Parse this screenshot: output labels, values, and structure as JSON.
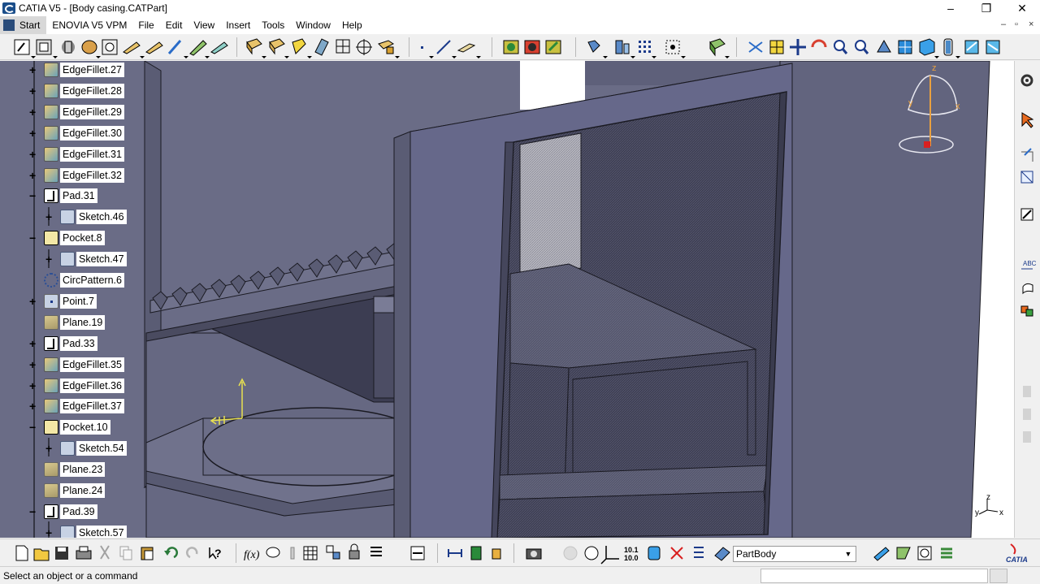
{
  "window": {
    "title": "CATIA V5 - [Body casing.CATPart]",
    "minimize": "–",
    "restore": "❐",
    "close": "✕"
  },
  "menu": {
    "items": [
      "Start",
      "ENOVIA V5 VPM",
      "File",
      "Edit",
      "View",
      "Insert",
      "Tools",
      "Window",
      "Help"
    ],
    "mdi_controls": [
      "–",
      "▫",
      "×"
    ]
  },
  "spec_tree": {
    "items": [
      {
        "label": "EdgeFillet.27",
        "type": "fillet",
        "level": 0,
        "expand": "+"
      },
      {
        "label": "EdgeFillet.28",
        "type": "fillet",
        "level": 0,
        "expand": "+"
      },
      {
        "label": "EdgeFillet.29",
        "type": "fillet",
        "level": 0,
        "expand": "+"
      },
      {
        "label": "EdgeFillet.30",
        "type": "fillet",
        "level": 0,
        "expand": "+"
      },
      {
        "label": "EdgeFillet.31",
        "type": "fillet",
        "level": 0,
        "expand": "+"
      },
      {
        "label": "EdgeFillet.32",
        "type": "fillet",
        "level": 0,
        "expand": "+"
      },
      {
        "label": "Pad.31",
        "type": "pad",
        "level": 0,
        "expand": "−"
      },
      {
        "label": "Sketch.46",
        "type": "sketch",
        "level": 1,
        "expand": "+"
      },
      {
        "label": "Pocket.8",
        "type": "pocket",
        "level": 0,
        "expand": "−"
      },
      {
        "label": "Sketch.47",
        "type": "sketch",
        "level": 1,
        "expand": "+"
      },
      {
        "label": "CircPattern.6",
        "type": "circ",
        "level": 0,
        "expand": ""
      },
      {
        "label": "Point.7",
        "type": "point",
        "level": 0,
        "expand": "+"
      },
      {
        "label": "Plane.19",
        "type": "plane",
        "level": 0,
        "expand": ""
      },
      {
        "label": "Pad.33",
        "type": "pad",
        "level": 0,
        "expand": "+"
      },
      {
        "label": "EdgeFillet.35",
        "type": "fillet",
        "level": 0,
        "expand": "+"
      },
      {
        "label": "EdgeFillet.36",
        "type": "fillet",
        "level": 0,
        "expand": "+"
      },
      {
        "label": "EdgeFillet.37",
        "type": "fillet",
        "level": 0,
        "expand": "+"
      },
      {
        "label": "Pocket.10",
        "type": "pocket",
        "level": 0,
        "expand": "−"
      },
      {
        "label": "Sketch.54",
        "type": "sketch",
        "level": 1,
        "expand": "+"
      },
      {
        "label": "Plane.23",
        "type": "plane",
        "level": 0,
        "expand": ""
      },
      {
        "label": "Plane.24",
        "type": "plane",
        "level": 0,
        "expand": ""
      },
      {
        "label": "Pad.39",
        "type": "pad",
        "level": 0,
        "expand": "−"
      },
      {
        "label": "Sketch.57",
        "type": "sketch",
        "level": 1,
        "expand": "+"
      }
    ]
  },
  "compass": {
    "x_label": "x",
    "y_label": "y",
    "z_label": "z"
  },
  "axis_triad": {
    "x_label": "x",
    "y_label": "y",
    "z_label": "z"
  },
  "bottom_toolbar": {
    "partbody_value": "PartBody",
    "fx_label": "f(x)",
    "coord_label": "10.1\n10.0"
  },
  "status": {
    "text": "Select an object or a command"
  },
  "colors": {
    "viewport_bg": "#6a6c86",
    "part_face": "#5d5f78",
    "part_dark": "#3c3d52",
    "edge": "#1a1a22",
    "tree_bg": "#ffffff"
  }
}
